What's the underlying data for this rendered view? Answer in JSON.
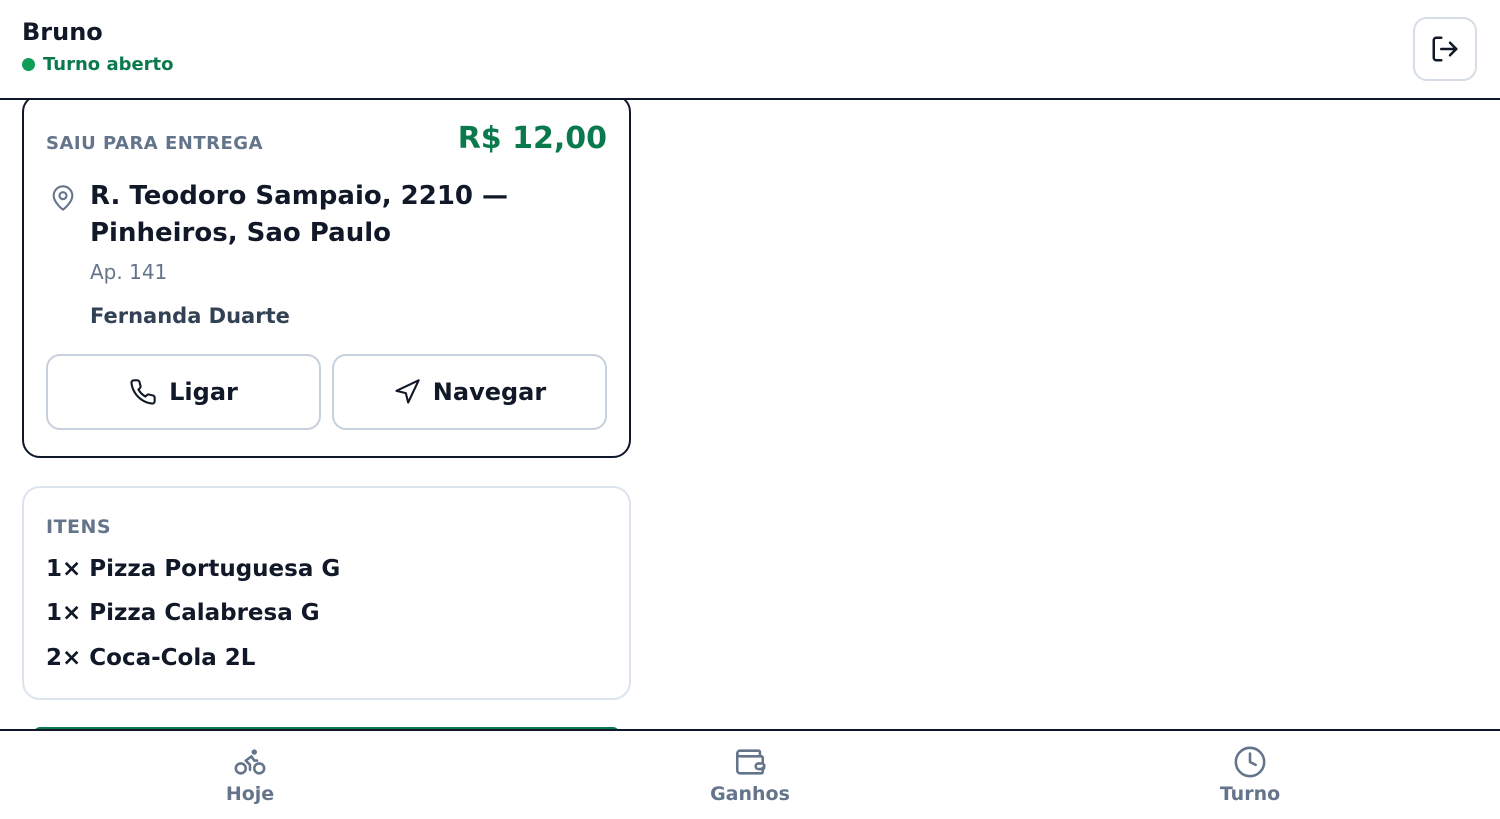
{
  "header": {
    "user_name": "Bruno",
    "status": "Turno aberto",
    "status_color": "#0f9d58",
    "logout_icon": "logout-icon"
  },
  "delivery": {
    "status": "SAIU PARA ENTREGA",
    "price": "R$ 12,00",
    "address_line1": "R. Teodoro Sampaio, 2210 —",
    "address_line2": "Pinheiros, Sao Paulo",
    "complement": "Ap. 141",
    "customer": "Fernanda Duarte",
    "call_label": "Ligar",
    "navigate_label": "Navegar"
  },
  "items": {
    "title": "ITENS",
    "list": [
      "1× Pizza Portuguesa G",
      "1× Pizza Calabresa G",
      "2× Coca-Cola 2L"
    ]
  },
  "nav": {
    "items": [
      {
        "label": "Hoje",
        "icon": "bike-icon"
      },
      {
        "label": "Ganhos",
        "icon": "wallet-icon"
      },
      {
        "label": "Turno",
        "icon": "clock-icon"
      }
    ]
  },
  "colors": {
    "accent": "#0a7a4d",
    "border_dark": "#0f172a",
    "muted_text": "#64748b"
  }
}
